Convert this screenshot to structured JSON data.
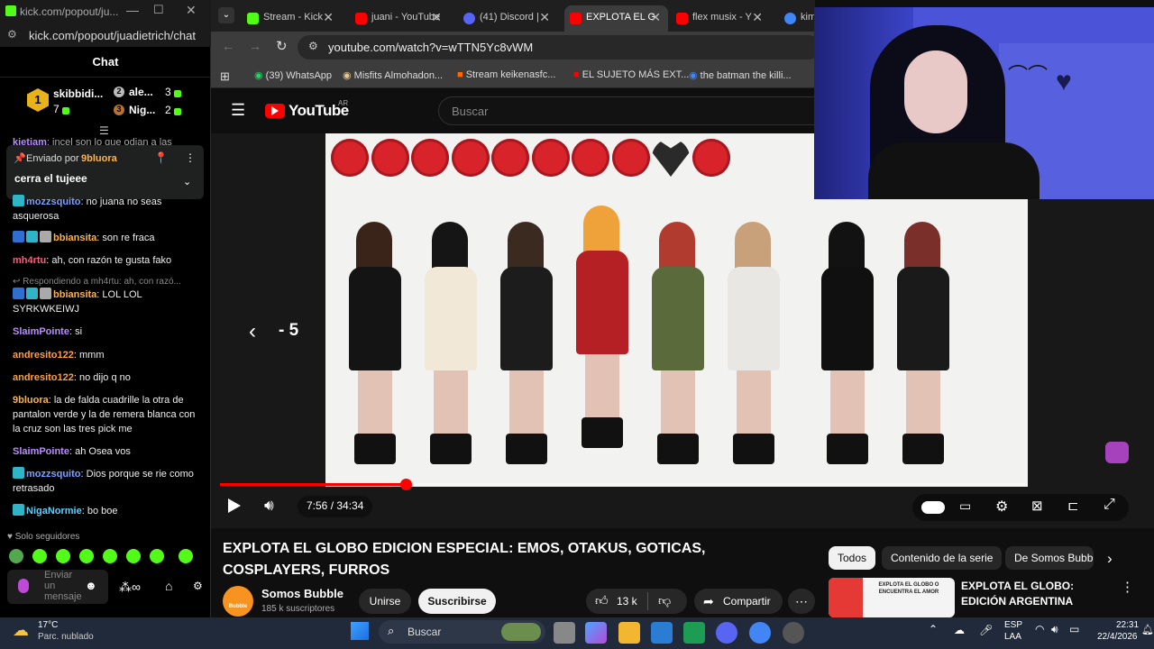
{
  "chat_window": {
    "title_url": "kick.com/popout/ju...",
    "url": "kick.com/popout/juadietrich/chat",
    "header": "Chat",
    "leaderboard": [
      {
        "rank": "1",
        "name": "skibbidi...",
        "count": "7"
      },
      {
        "rank": "2",
        "name": "ale...",
        "count": "3"
      },
      {
        "rank": "3",
        "name": "Nig...",
        "count": "2"
      }
    ],
    "pinned": {
      "label_prefix": "Enviado por",
      "by": "9bluora",
      "text": "cerra el tujeee"
    },
    "partial_top": {
      "user": "kietiam",
      "text": "incel son lo que odian a las"
    },
    "messages": [
      {
        "user": "mozzsquito",
        "text": "no juana no seas asquerosa",
        "color": "#7aa2ff"
      },
      {
        "user": "bbiansita",
        "text": "son re fraca",
        "color": "#ffb347"
      },
      {
        "user": "mh4rtu",
        "text": "ah, con razón te gusta fako",
        "color": "#ff5b7a"
      },
      {
        "reply": "Respondiendo a mh4rtu: ah, con razó..."
      },
      {
        "user": "bbiansita",
        "text": "LOL LOL SYRKWKEIWJ",
        "color": "#ffb347"
      },
      {
        "user": "SlaimPointe",
        "text": "si",
        "color": "#b98cff"
      },
      {
        "user": "andresito122",
        "text": "mmm",
        "color": "#ff9f43"
      },
      {
        "user": "andresito122",
        "text": "no dijo q no",
        "color": "#ff9f43"
      },
      {
        "user": "9bluora",
        "text": "la de falda cuadrille la otra de pantalon verde y la de remera blanca con la cruz son las tres pick me",
        "color": "#ffb347"
      },
      {
        "user": "SlaimPointe",
        "text": "ah Osea vos",
        "color": "#b98cff"
      },
      {
        "user": "mozzsquito",
        "text": "Dios porque se rie como retrasado",
        "color": "#7aa2ff"
      },
      {
        "user": "NigaNormie",
        "text": "bo boe",
        "color": "#5bd1ff"
      }
    ],
    "followers_only": "Solo seguidores",
    "input_placeholder": "Enviar un mensaje"
  },
  "browser": {
    "tabs": [
      {
        "label": "Stream - Kick",
        "color": "#53fc18"
      },
      {
        "label": "juani - YouTube",
        "color": "#ff0000"
      },
      {
        "label": "(41) Discord |",
        "color": "#5865f2"
      },
      {
        "label": "EXPLOTA EL G",
        "color": "#ff0000",
        "active": true
      },
      {
        "label": "flex musix - Y",
        "color": "#ff0000"
      },
      {
        "label": "kim",
        "color": "#4285f4"
      }
    ],
    "url": "youtube.com/watch?v=wTTN5Yc8vWM",
    "bookmarks": [
      "(39) WhatsApp",
      "Misfits Almohadon...",
      "Stream keikenasfc...",
      "EL SUJETO MÁS EXT...",
      "the batman the killi..."
    ]
  },
  "youtube": {
    "logo_text": "YouTube",
    "region": "AR",
    "search_placeholder": "Buscar",
    "time_current": "7:56",
    "time_sep": " / ",
    "time_total": "34:34",
    "progress": 0.23,
    "seek_label": "- 5",
    "title": "EXPLOTA EL GLOBO EDICION ESPECIAL: EMOS, OTAKUS, GOTICAS, COSPLAYERS, FURROS",
    "channel": "Somos Bubble",
    "channel_badge": "Bubble",
    "subscribers": "185 k suscriptores",
    "join": "Unirse",
    "subscribe": "Suscribirse",
    "likes": "13 k",
    "share": "Compartir",
    "chips": [
      "Todos",
      "Contenido de la serie",
      "De Somos Bubble"
    ],
    "related_title": "EXPLOTA EL GLOBO: EDICIÓN ARGENTINA",
    "related_thumb_text": "EXPLOTA EL GLOBO O ENCUENTRA EL AMOR"
  },
  "taskbar": {
    "weather_temp": "17°C",
    "weather_desc": "Parc. nublado",
    "search": "Buscar",
    "lang1": "ESP",
    "lang2": "LAA",
    "time": "22:31",
    "date": "22/4/2026"
  }
}
